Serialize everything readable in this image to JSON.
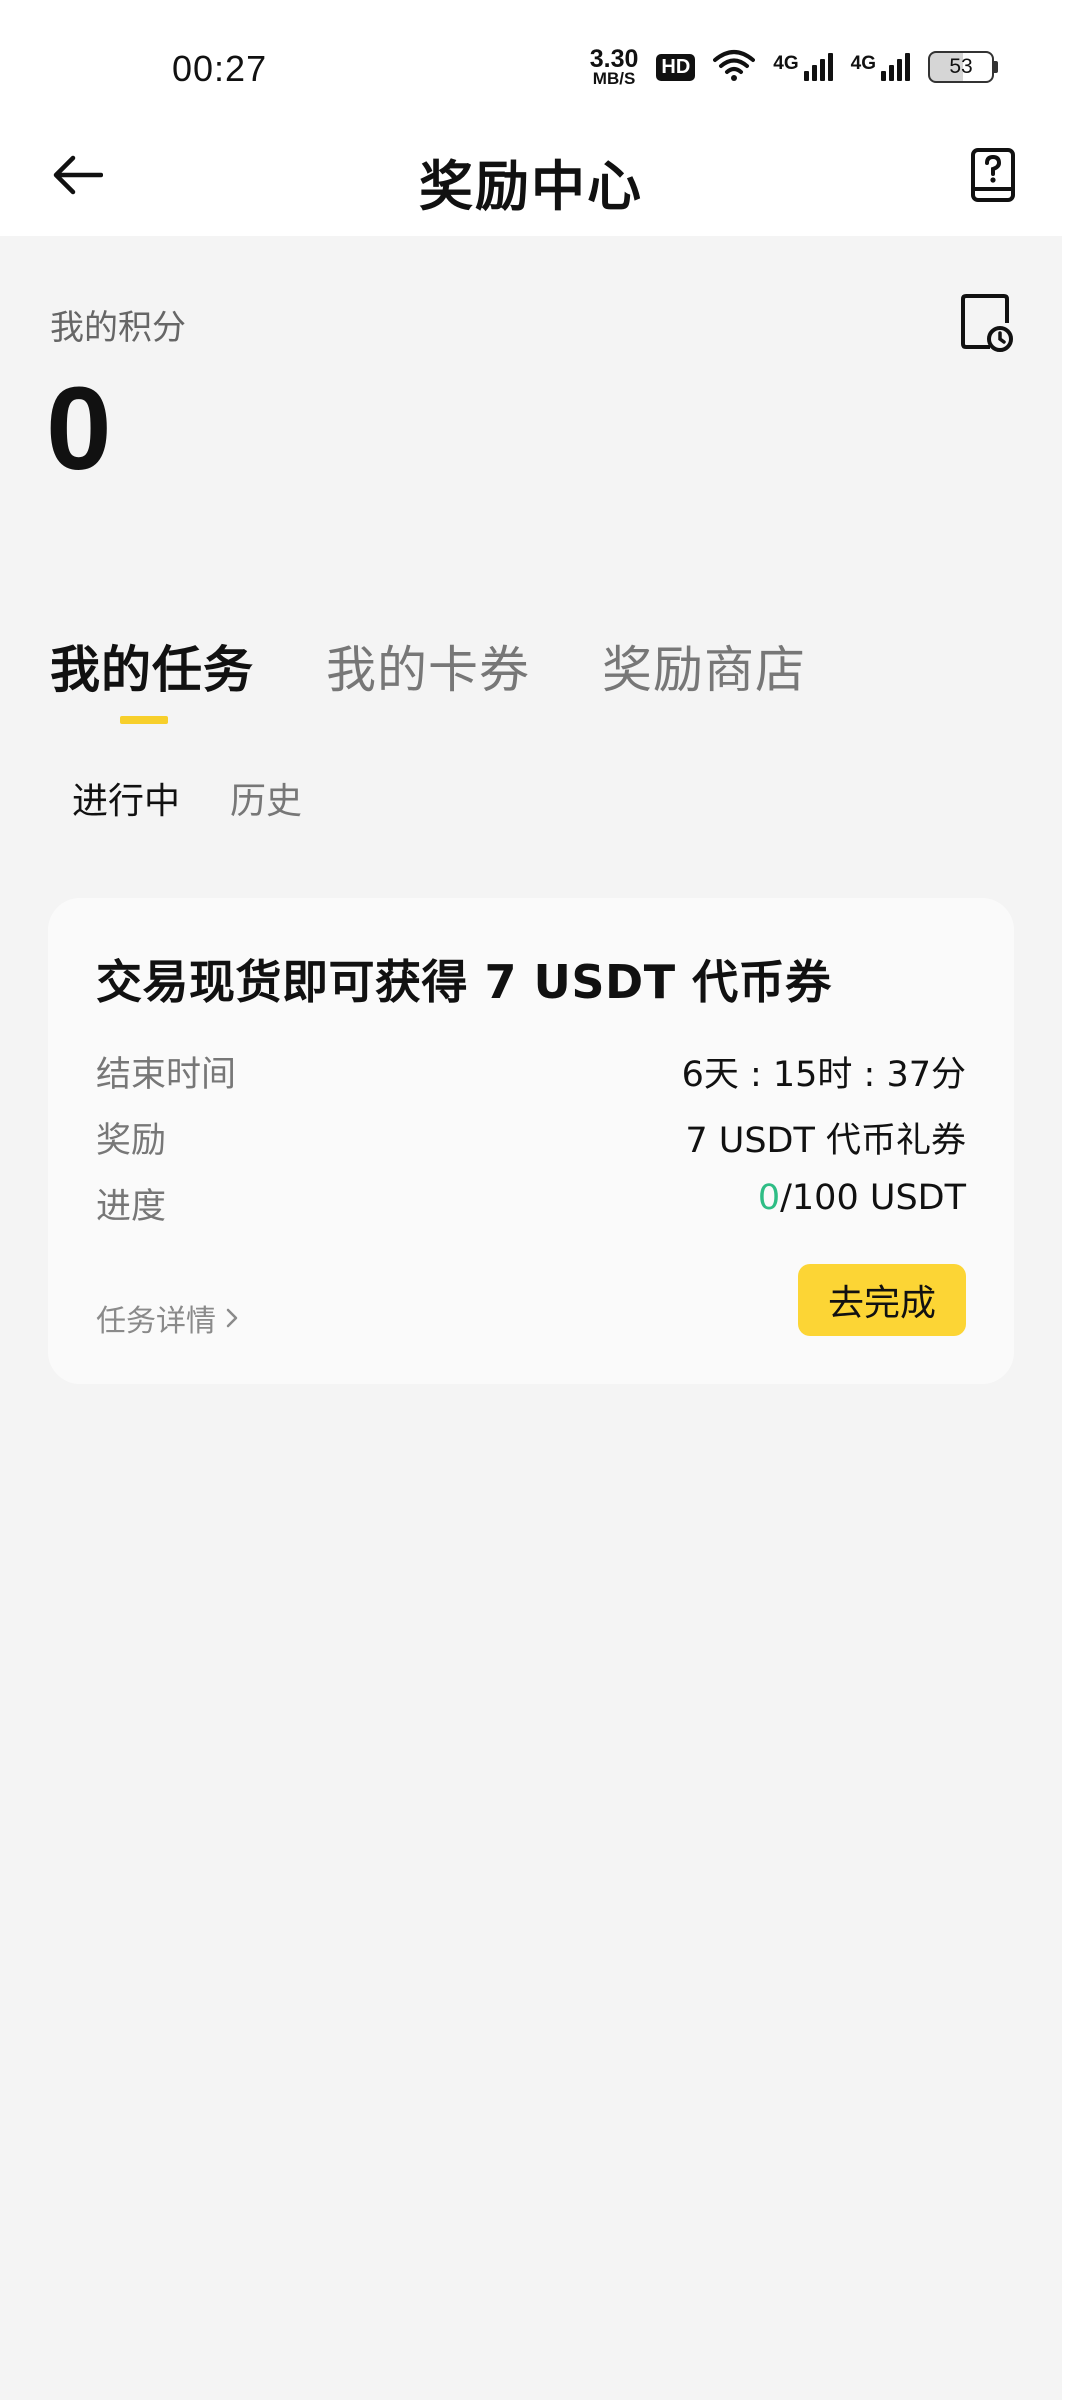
{
  "status_bar": {
    "time": "00:27",
    "net_speed_value": "3.30",
    "net_speed_unit": "MB/S",
    "hd_label": "HD",
    "signal_1_label": "4G",
    "signal_2_label": "4G",
    "battery": "53"
  },
  "header": {
    "title": "奖励中心",
    "back_icon": "arrow-left-icon",
    "help_icon": "help-book-icon"
  },
  "points": {
    "label": "我的积分",
    "value": "0",
    "history_icon": "points-history-icon"
  },
  "main_tabs": [
    {
      "label": "我的任务",
      "active": true
    },
    {
      "label": "我的卡券",
      "active": false
    },
    {
      "label": "奖励商店",
      "active": false
    }
  ],
  "sub_tabs": [
    {
      "label": "进行中",
      "active": true
    },
    {
      "label": "历史",
      "active": false
    }
  ],
  "task": {
    "title": "交易现货即可获得 7 USDT 代币券",
    "end_time_label": "结束时间",
    "end_time_value": "6天 : 15时 : 37分",
    "reward_label": "奖励",
    "reward_value": "7 USDT 代币礼券",
    "progress_label": "进度",
    "progress_current": "0",
    "progress_total": "/100 USDT",
    "detail_link": "任务详情",
    "action_button": "去完成"
  },
  "colors": {
    "accent_yellow": "#fcd535",
    "progress_green": "#2ebd85",
    "background": "#f4f4f4"
  }
}
